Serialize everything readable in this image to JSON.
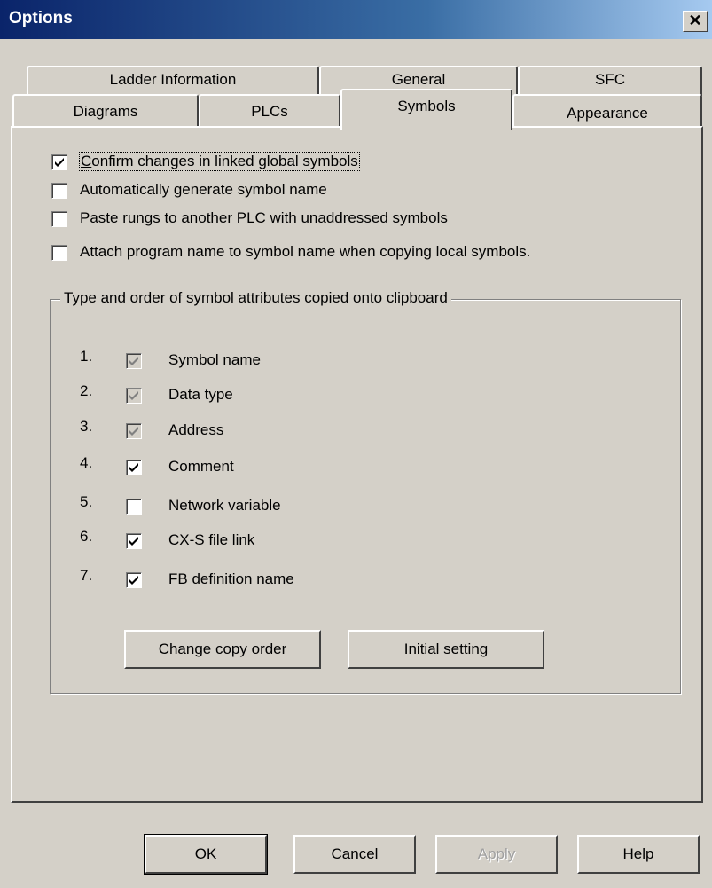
{
  "window": {
    "title": "Options",
    "close_glyph": "✕"
  },
  "tabs": {
    "row1": [
      {
        "label": "Ladder Information"
      },
      {
        "label": "General"
      },
      {
        "label": "SFC"
      }
    ],
    "row2": [
      {
        "label": "Diagrams"
      },
      {
        "label": "PLCs"
      },
      {
        "label": "Symbols",
        "active": true
      },
      {
        "label": "Appearance"
      }
    ]
  },
  "options": [
    {
      "label": "Confirm changes in linked global symbols",
      "checked": true
    },
    {
      "label": "Automatically generate symbol name",
      "checked": false
    },
    {
      "label": "Paste rungs to another PLC with unaddressed symbols",
      "checked": false
    },
    {
      "label": "Attach program name to symbol name when copying local symbols.",
      "checked": false
    }
  ],
  "attributes_group": {
    "title": "Type and order of symbol attributes copied onto clipboard",
    "items": [
      {
        "num": "1.",
        "label": "Symbol name",
        "checked": true,
        "enabled": false
      },
      {
        "num": "2.",
        "label": "Data type",
        "checked": true,
        "enabled": false
      },
      {
        "num": "3.",
        "label": "Address",
        "checked": true,
        "enabled": false
      },
      {
        "num": "4.",
        "label": "Comment",
        "checked": true,
        "enabled": true
      },
      {
        "num": "5.",
        "label": "Network variable",
        "checked": false,
        "enabled": true
      },
      {
        "num": "6.",
        "label": "CX-S file link",
        "checked": true,
        "enabled": true
      },
      {
        "num": "7.",
        "label": "FB definition name",
        "checked": true,
        "enabled": true
      }
    ],
    "change_order_label": "Change copy order",
    "initial_setting_label": "Initial setting"
  },
  "footer": {
    "ok_label": "OK",
    "cancel_label": "Cancel",
    "apply_label": "Apply",
    "help_label": "Help"
  }
}
